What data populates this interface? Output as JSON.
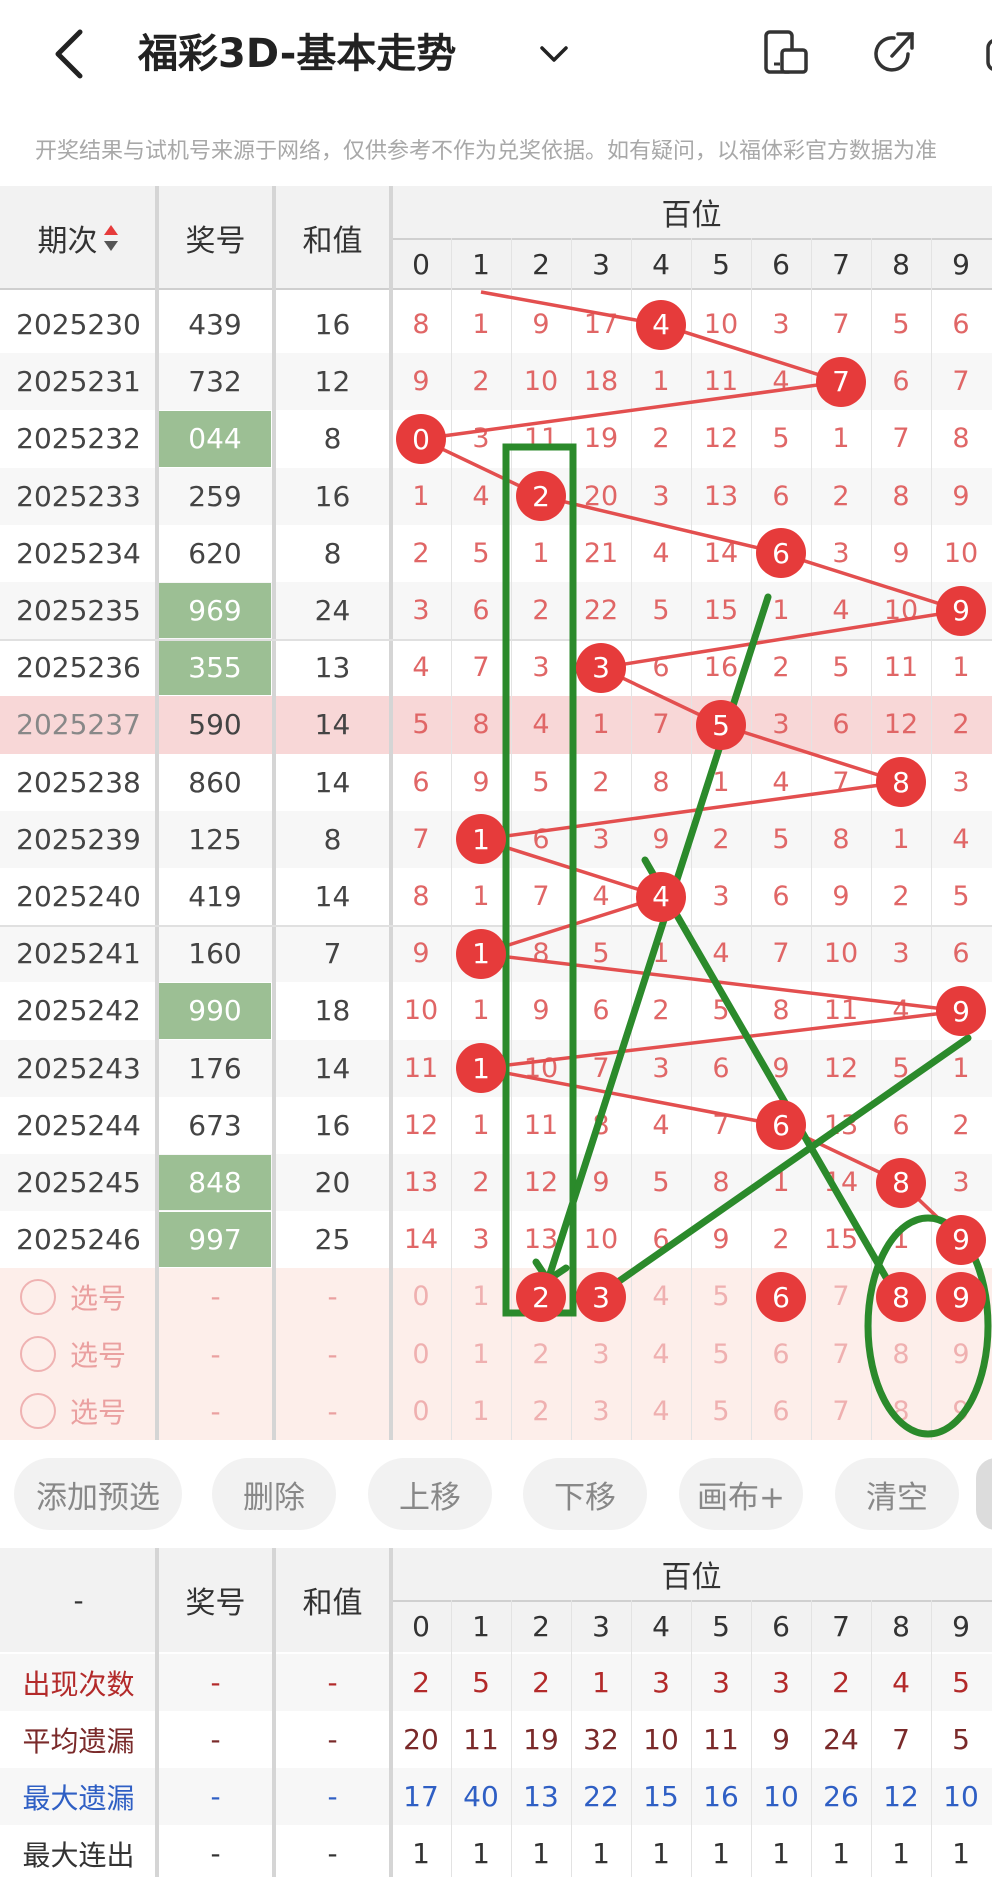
{
  "header": {
    "back_icon": "chevron-left-icon",
    "title": "福彩3D-基本走势",
    "dropdown_icon": "chevron-down-icon",
    "icons": [
      "phone-rotate-icon",
      "share-icon",
      "more-icon"
    ]
  },
  "notice": "开奖结果与试机号来源于网络，仅供参考不作为兑奖依据。如有疑问，以福体彩官方数据为准",
  "table": {
    "headers": {
      "period": "期次",
      "number": "奖号",
      "sum": "和值",
      "hundreds": "百位"
    },
    "digits": [
      "0",
      "1",
      "2",
      "3",
      "4",
      "5",
      "6",
      "7",
      "8",
      "9"
    ],
    "rows": [
      {
        "period": "2025230",
        "number": "439",
        "sum": "16",
        "hl": false,
        "miss": [
          "8",
          "1",
          "9",
          "17",
          "4",
          "10",
          "3",
          "7",
          "5",
          "6"
        ],
        "hit": 4
      },
      {
        "period": "2025231",
        "number": "732",
        "sum": "12",
        "hl": false,
        "miss": [
          "9",
          "2",
          "10",
          "18",
          "1",
          "11",
          "4",
          "7",
          "6",
          "7"
        ],
        "hit": 7
      },
      {
        "period": "2025232",
        "number": "044",
        "sum": "8",
        "hl": true,
        "miss": [
          "0",
          "3",
          "11",
          "19",
          "2",
          "12",
          "5",
          "1",
          "7",
          "8"
        ],
        "hit": 0
      },
      {
        "period": "2025233",
        "number": "259",
        "sum": "16",
        "hl": false,
        "miss": [
          "1",
          "4",
          "2",
          "20",
          "3",
          "13",
          "6",
          "2",
          "8",
          "9"
        ],
        "hit": 2
      },
      {
        "period": "2025234",
        "number": "620",
        "sum": "8",
        "hl": false,
        "miss": [
          "2",
          "5",
          "1",
          "21",
          "4",
          "14",
          "6",
          "3",
          "9",
          "10"
        ],
        "hit": 6
      },
      {
        "period": "2025235",
        "number": "969",
        "sum": "24",
        "hl": true,
        "miss": [
          "3",
          "6",
          "2",
          "22",
          "5",
          "15",
          "1",
          "4",
          "10",
          "9"
        ],
        "hit": 9
      },
      {
        "period": "2025236",
        "number": "355",
        "sum": "13",
        "hl": true,
        "miss": [
          "4",
          "7",
          "3",
          "3",
          "6",
          "16",
          "2",
          "5",
          "11",
          "1"
        ],
        "hit": 3
      },
      {
        "period": "2025237",
        "number": "590",
        "sum": "14",
        "hl": false,
        "miss": [
          "5",
          "8",
          "4",
          "1",
          "7",
          "5",
          "3",
          "6",
          "12",
          "2"
        ],
        "hit": 5
      },
      {
        "period": "2025238",
        "number": "860",
        "sum": "14",
        "hl": false,
        "miss": [
          "6",
          "9",
          "5",
          "2",
          "8",
          "1",
          "4",
          "7",
          "8",
          "3"
        ],
        "hit": 8
      },
      {
        "period": "2025239",
        "number": "125",
        "sum": "8",
        "hl": false,
        "miss": [
          "7",
          "1",
          "6",
          "3",
          "9",
          "2",
          "5",
          "8",
          "1",
          "4"
        ],
        "hit": 1
      },
      {
        "period": "2025240",
        "number": "419",
        "sum": "14",
        "hl": false,
        "miss": [
          "8",
          "1",
          "7",
          "4",
          "4",
          "3",
          "6",
          "9",
          "2",
          "5"
        ],
        "hit": 4
      },
      {
        "period": "2025241",
        "number": "160",
        "sum": "7",
        "hl": false,
        "miss": [
          "9",
          "1",
          "8",
          "5",
          "1",
          "4",
          "7",
          "10",
          "3",
          "6"
        ],
        "hit": 1
      },
      {
        "period": "2025242",
        "number": "990",
        "sum": "18",
        "hl": true,
        "miss": [
          "10",
          "1",
          "9",
          "6",
          "2",
          "5",
          "8",
          "11",
          "4",
          "9"
        ],
        "hit": 9
      },
      {
        "period": "2025243",
        "number": "176",
        "sum": "14",
        "hl": false,
        "miss": [
          "11",
          "1",
          "10",
          "7",
          "3",
          "6",
          "9",
          "12",
          "5",
          "1"
        ],
        "hit": 1
      },
      {
        "period": "2025244",
        "number": "673",
        "sum": "16",
        "hl": false,
        "miss": [
          "12",
          "1",
          "11",
          "8",
          "4",
          "7",
          "6",
          "13",
          "6",
          "2"
        ],
        "hit": 6
      },
      {
        "period": "2025245",
        "number": "848",
        "sum": "20",
        "hl": true,
        "miss": [
          "13",
          "2",
          "12",
          "9",
          "5",
          "8",
          "1",
          "14",
          "8",
          "3"
        ],
        "hit": 8
      },
      {
        "period": "2025246",
        "number": "997",
        "sum": "25",
        "hl": true,
        "miss": [
          "14",
          "3",
          "13",
          "10",
          "6",
          "9",
          "2",
          "15",
          "1",
          "9"
        ],
        "hit": 9
      }
    ],
    "highlight_period": "2025237",
    "select_rows": [
      {
        "label": "选号",
        "number": "-",
        "sum": "-",
        "picked": [
          2,
          3,
          6,
          8,
          9
        ]
      },
      {
        "label": "选号",
        "number": "-",
        "sum": "-",
        "picked": []
      },
      {
        "label": "选号",
        "number": "-",
        "sum": "-",
        "picked": []
      }
    ]
  },
  "buttons": [
    "添加预选",
    "删除",
    "上移",
    "下移",
    "画布+",
    "清空"
  ],
  "stats": {
    "headers": {
      "first": "-",
      "number": "奖号",
      "sum": "和值",
      "hundreds": "百位"
    },
    "rows": [
      {
        "label": "出现次数",
        "color": "#b32a2a",
        "number": "-",
        "sum": "-",
        "values": [
          "2",
          "5",
          "2",
          "1",
          "3",
          "3",
          "3",
          "2",
          "4",
          "5"
        ]
      },
      {
        "label": "平均遗漏",
        "color": "#7a2a2a",
        "number": "-",
        "sum": "-",
        "values": [
          "20",
          "11",
          "19",
          "32",
          "10",
          "11",
          "9",
          "24",
          "7",
          "5"
        ]
      },
      {
        "label": "最大遗漏",
        "color": "#2f5fc4",
        "number": "-",
        "sum": "-",
        "values": [
          "17",
          "40",
          "13",
          "22",
          "15",
          "16",
          "10",
          "26",
          "12",
          "10"
        ]
      },
      {
        "label": "最大连出",
        "color": "#333333",
        "number": "-",
        "sum": "-",
        "values": [
          "1",
          "1",
          "1",
          "1",
          "1",
          "1",
          "1",
          "1",
          "1",
          "1"
        ]
      }
    ]
  },
  "colors": {
    "accent": "#e63b3b",
    "hl_green": "#9cbf94",
    "hl_row": "#f8d7d7",
    "select_bg": "#fdeeea",
    "annotation": "#2b8a2b"
  }
}
